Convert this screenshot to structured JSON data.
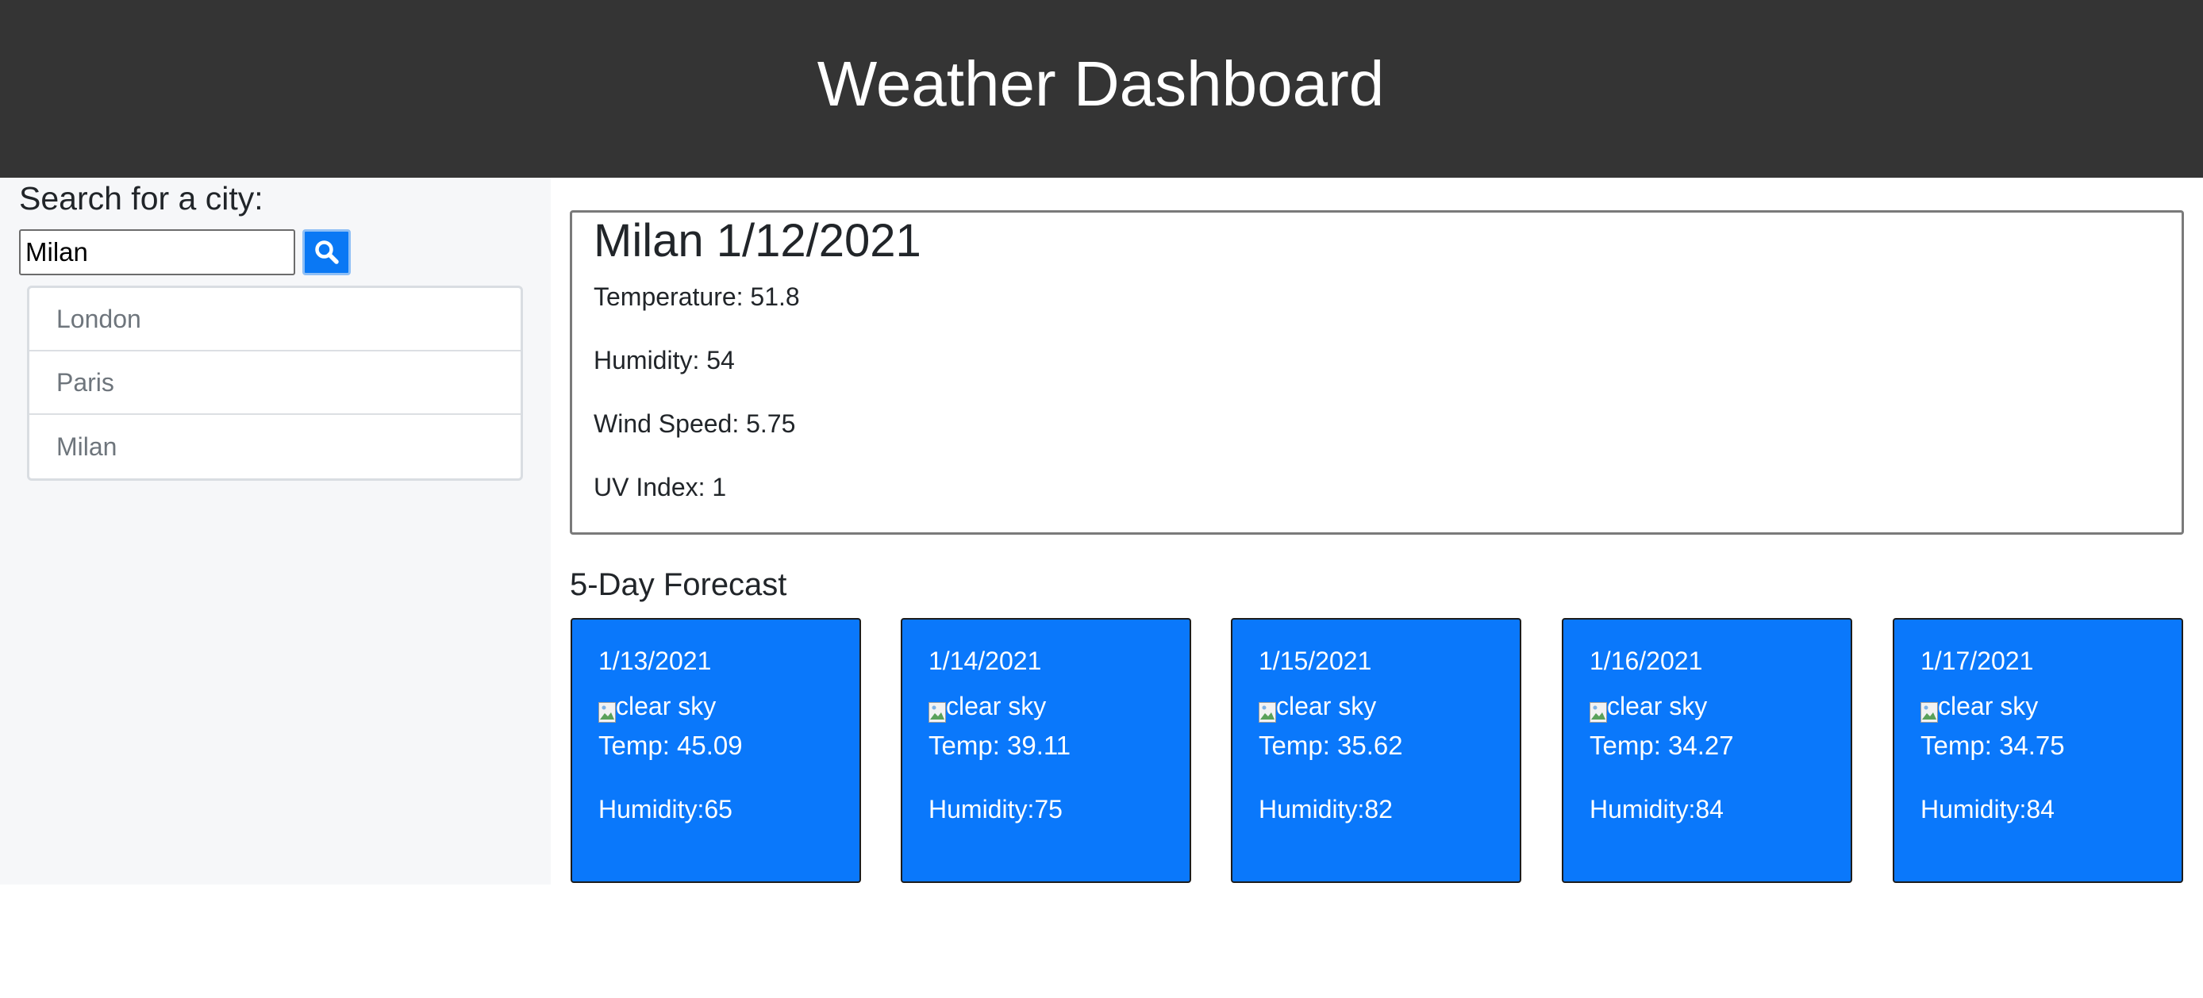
{
  "header": {
    "title": "Weather Dashboard"
  },
  "search": {
    "label": "Search for a city:",
    "value": "Milan",
    "button_icon": "search-icon",
    "button_color": "#0a78f4"
  },
  "history": [
    "London",
    "Paris",
    "Milan"
  ],
  "current": {
    "heading": "Milan 1/12/2021",
    "temperature": "Temperature: 51.8",
    "humidity": "Humidity: 54",
    "wind": "Wind Speed: 5.75",
    "uv": "UV Index: 1"
  },
  "forecast": {
    "title": "5-Day Forecast",
    "card_color": "#0a78fb",
    "days": [
      {
        "date": "1/13/2021",
        "alt": "clear sky",
        "temp": "Temp: 45.09",
        "humidity": "Humidity:65"
      },
      {
        "date": "1/14/2021",
        "alt": "clear sky",
        "temp": "Temp: 39.11",
        "humidity": "Humidity:75"
      },
      {
        "date": "1/15/2021",
        "alt": "clear sky",
        "temp": "Temp: 35.62",
        "humidity": "Humidity:82"
      },
      {
        "date": "1/16/2021",
        "alt": "clear sky",
        "temp": "Temp: 34.27",
        "humidity": "Humidity:84"
      },
      {
        "date": "1/17/2021",
        "alt": "clear sky",
        "temp": "Temp: 34.75",
        "humidity": "Humidity:84"
      }
    ]
  }
}
